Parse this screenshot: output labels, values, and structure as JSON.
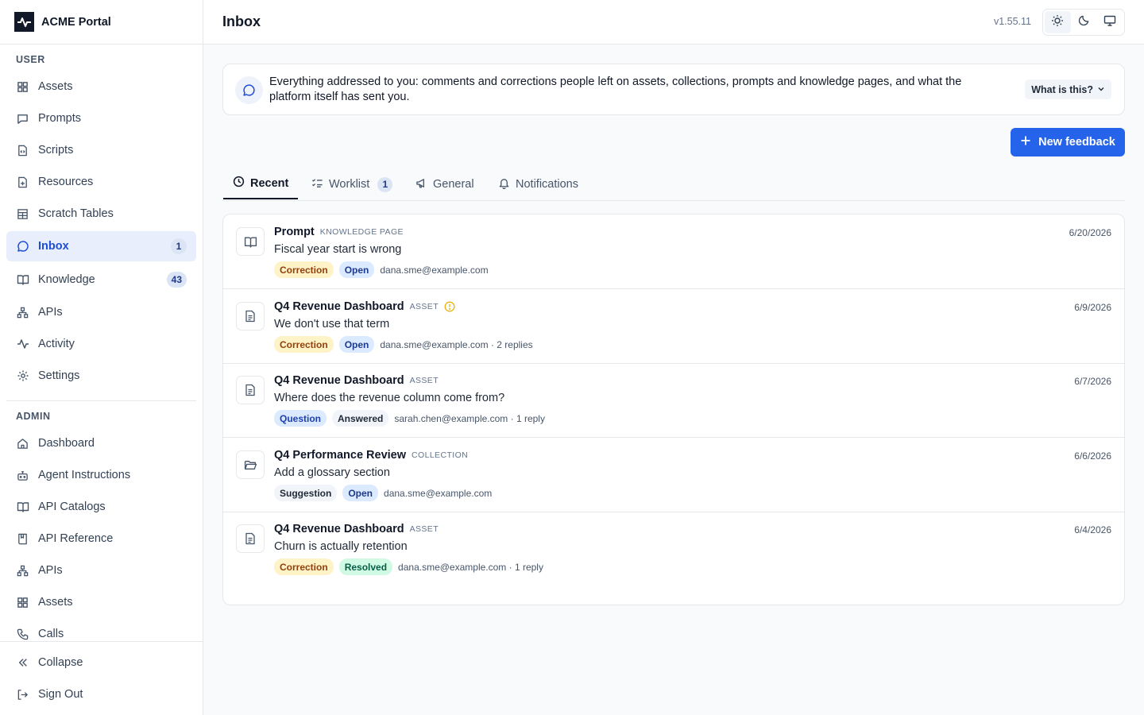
{
  "brand": {
    "name": "ACME Portal"
  },
  "sidebar": {
    "user_label": "USER",
    "user_items": [
      {
        "label": "Assets",
        "icon": "grid-icon"
      },
      {
        "label": "Prompts",
        "icon": "message-square-icon"
      },
      {
        "label": "Scripts",
        "icon": "file-code-icon"
      },
      {
        "label": "Resources",
        "icon": "file-plus-icon"
      },
      {
        "label": "Scratch Tables",
        "icon": "table-icon"
      },
      {
        "label": "Inbox",
        "icon": "chat-bubble-icon",
        "count": "1",
        "active": true
      },
      {
        "label": "Knowledge",
        "icon": "book-open-icon",
        "count": "43"
      },
      {
        "label": "APIs",
        "icon": "network-icon"
      },
      {
        "label": "Activity",
        "icon": "activity-icon"
      },
      {
        "label": "Settings",
        "icon": "gear-icon"
      }
    ],
    "admin_label": "ADMIN",
    "admin_items": [
      {
        "label": "Dashboard",
        "icon": "home-icon"
      },
      {
        "label": "Agent Instructions",
        "icon": "bot-icon"
      },
      {
        "label": "API Catalogs",
        "icon": "book-open-icon"
      },
      {
        "label": "API Reference",
        "icon": "book-bookmark-icon"
      },
      {
        "label": "APIs",
        "icon": "network-icon"
      },
      {
        "label": "Assets",
        "icon": "grid-icon"
      },
      {
        "label": "Calls",
        "icon": "phone-icon"
      }
    ],
    "collapse_label": "Collapse",
    "signout_label": "Sign Out"
  },
  "header": {
    "title": "Inbox",
    "version": "v1.55.11"
  },
  "info": {
    "text": "Everything addressed to you: comments and corrections people left on assets, collections, prompts and knowledge pages, and what the platform itself has sent you.",
    "what_label": "What is this?"
  },
  "new_feedback_label": "New feedback",
  "tabs": [
    {
      "label": "Recent",
      "icon": "clock-icon",
      "active": true
    },
    {
      "label": "Worklist",
      "icon": "list-checks-icon",
      "count": "1"
    },
    {
      "label": "General",
      "icon": "megaphone-icon"
    },
    {
      "label": "Notifications",
      "icon": "bell-icon"
    }
  ],
  "items": [
    {
      "title": "Prompt",
      "type": "KNOWLEDGE PAGE",
      "icon": "book-open-icon",
      "subject": "Fiscal year start is wrong",
      "kind": "Correction",
      "status": "Open",
      "meta": "dana.sme@example.com",
      "date": "6/20/2026",
      "warning": false
    },
    {
      "title": "Q4 Revenue Dashboard",
      "type": "ASSET",
      "icon": "document-icon",
      "subject": "We don't use that term",
      "kind": "Correction",
      "status": "Open",
      "meta": "dana.sme@example.com · 2 replies",
      "date": "6/9/2026",
      "warning": true
    },
    {
      "title": "Q4 Revenue Dashboard",
      "type": "ASSET",
      "icon": "document-icon",
      "subject": "Where does the revenue column come from?",
      "kind": "Question",
      "status": "Answered",
      "meta": "sarah.chen@example.com · 1 reply",
      "date": "6/7/2026",
      "warning": false
    },
    {
      "title": "Q4 Performance Review",
      "type": "COLLECTION",
      "icon": "folder-open-icon",
      "subject": "Add a glossary section",
      "kind": "Suggestion",
      "status": "Open",
      "meta": "dana.sme@example.com",
      "date": "6/6/2026",
      "warning": false
    },
    {
      "title": "Q4 Revenue Dashboard",
      "type": "ASSET",
      "icon": "document-icon",
      "subject": "Churn is actually retention",
      "kind": "Correction",
      "status": "Resolved",
      "meta": "dana.sme@example.com · 1 reply",
      "date": "6/4/2026",
      "warning": false
    }
  ]
}
